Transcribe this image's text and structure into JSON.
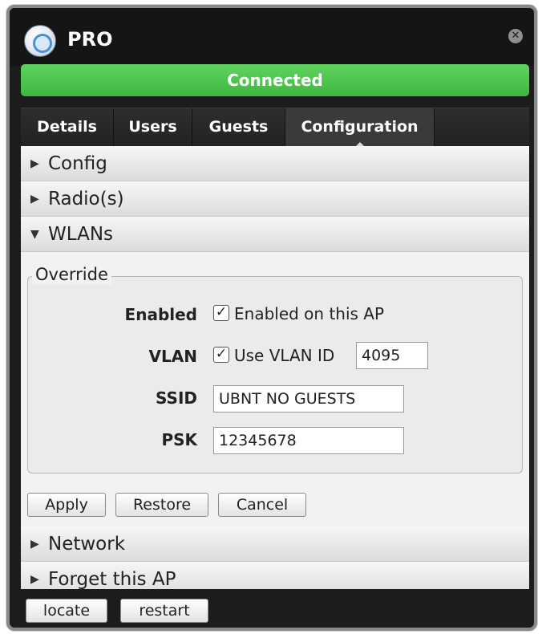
{
  "window": {
    "title": "PRO",
    "close_icon": "close-icon",
    "ap_icon": "access-point-icon"
  },
  "status": {
    "text": "Connected",
    "color": "#47c447"
  },
  "tabs": [
    {
      "label": "Details"
    },
    {
      "label": "Users"
    },
    {
      "label": "Guests"
    },
    {
      "label": "Configuration",
      "active": true
    }
  ],
  "sections": {
    "config": "Config",
    "radios": "Radio(s)",
    "wlans": "WLANs",
    "network": "Network",
    "forget": "Forget this AP"
  },
  "override": {
    "legend": "Override",
    "enabled_label": "Enabled",
    "enabled_checkbox_text": "Enabled on this AP",
    "enabled_checked": true,
    "vlan_label": "VLAN",
    "vlan_checkbox_text": "Use VLAN ID",
    "vlan_checked": true,
    "vlan_id": "4095",
    "ssid_label": "SSID",
    "ssid_value": "UBNT NO GUESTS",
    "psk_label": "PSK",
    "psk_value": "12345678"
  },
  "actions": {
    "apply": "Apply",
    "restore": "Restore",
    "cancel": "Cancel"
  },
  "footer": {
    "locate": "locate",
    "restart": "restart"
  }
}
